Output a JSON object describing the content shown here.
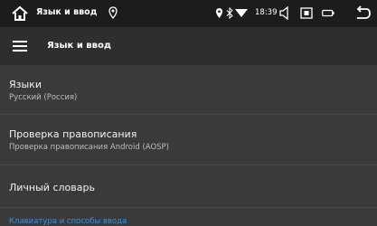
{
  "statusbar": {
    "title": "Язык и ввод",
    "time": "18:39",
    "icons": [
      "home-icon",
      "location-icon",
      "location-icon",
      "bluetooth-icon",
      "wifi-icon",
      "volume-icon",
      "screenshot-icon",
      "battery-icon",
      "back-icon"
    ]
  },
  "toolbar": {
    "title": "Язык и ввод",
    "menu_icon": "hamburger-menu-icon"
  },
  "items": [
    {
      "title": "Языки",
      "subtitle": "Русский (Россия)"
    },
    {
      "title": "Проверка правописания",
      "subtitle": "Проверка правописания Android (AOSP)"
    },
    {
      "title": "Личный словарь"
    }
  ],
  "section_header": "Клавиатура и способы ввода",
  "colors": {
    "statusbar_bg": "#1c1c1c",
    "toolbar_bg": "#2e2e2e",
    "content_bg": "#3a3a3a",
    "accent": "#3f8fd6"
  }
}
